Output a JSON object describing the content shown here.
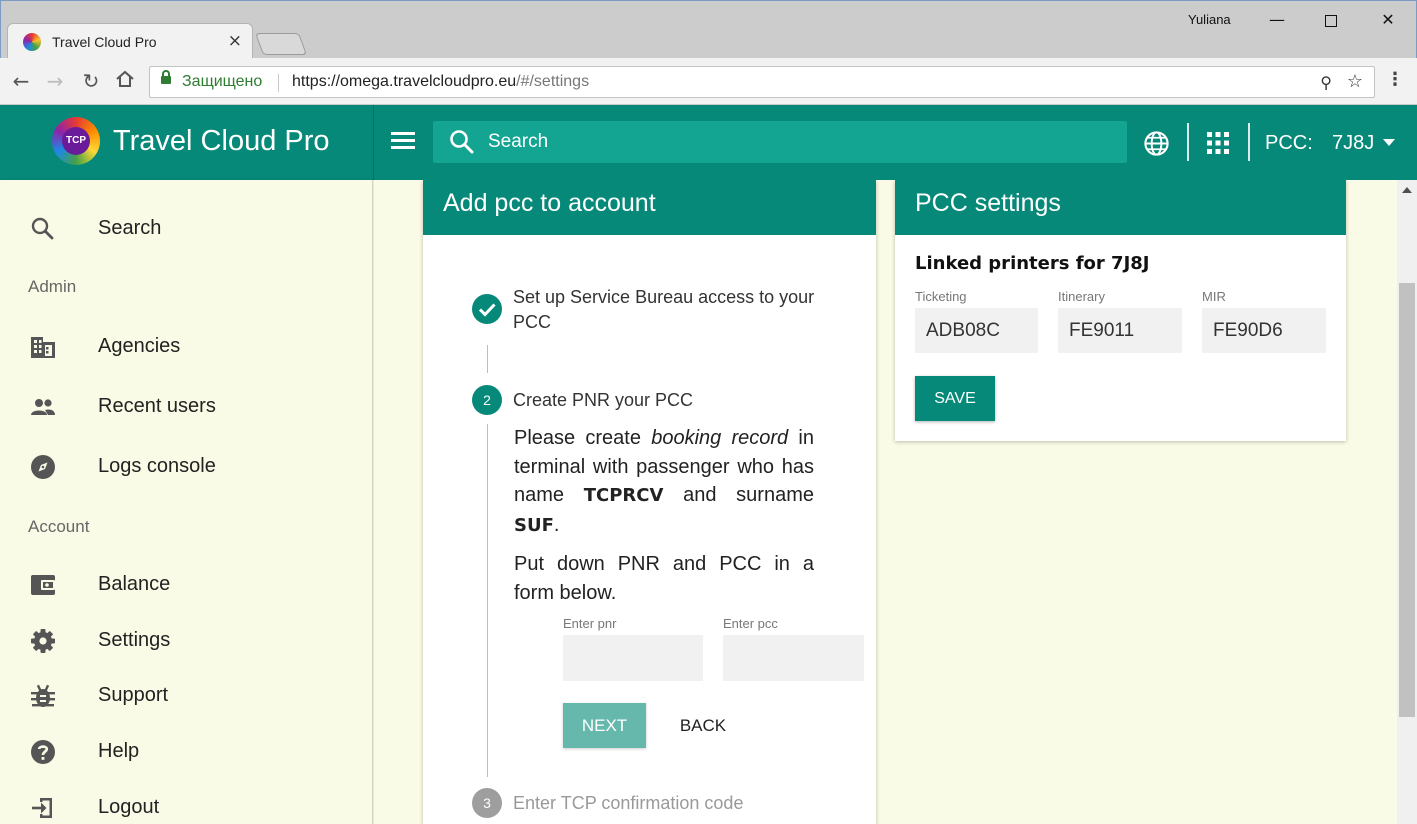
{
  "browser": {
    "tab_title": "Travel Cloud Pro",
    "tab_close": "×",
    "window_user": "Yuliana",
    "secure_label": "Защищено",
    "url_host": "https://omega.travelcloudpro.eu",
    "url_path": "/#/settings"
  },
  "header": {
    "brand_name": "Travel Cloud Pro",
    "logo_text": "TCP",
    "search_placeholder": "Search",
    "pcc_label": "PCC:",
    "pcc_value": "7J8J"
  },
  "sidebar": {
    "search_label": "Search",
    "admin_section": "Admin",
    "account_section": "Account",
    "items": [
      {
        "label": "Agencies",
        "icon": "building-icon"
      },
      {
        "label": "Recent users",
        "icon": "people-icon"
      },
      {
        "label": "Logs console",
        "icon": "compass-icon"
      },
      {
        "label": "Balance",
        "icon": "wallet-icon"
      },
      {
        "label": "Settings",
        "icon": "gear-icon"
      },
      {
        "label": "Support",
        "icon": "bug-icon"
      },
      {
        "label": "Help",
        "icon": "help-icon"
      },
      {
        "label": "Logout",
        "icon": "logout-icon"
      }
    ]
  },
  "add_pcc": {
    "title": "Add pcc to account",
    "steps": [
      {
        "number": "",
        "title": "Set up Service Bureau access to your PCC",
        "status": "done"
      },
      {
        "number": "2",
        "title": "Create PNR your PCC",
        "status": "active"
      },
      {
        "number": "3",
        "title": "Enter TCP confirmation code",
        "status": "pending"
      }
    ],
    "body": {
      "p1_a": "Please create ",
      "p1_em": "booking record",
      "p1_b": " in terminal with passenger who has name ",
      "p1_name": "TCPRCV",
      "p1_c": " and surname ",
      "p1_surname": "SUF",
      "p1_d": ".",
      "p2": "Put down PNR and PCC in a form below."
    },
    "pnr_label": "Enter pnr",
    "pnr_value": "",
    "pcc_label": "Enter pcc",
    "pcc_value": "",
    "next_label": "NEXT",
    "back_label": "BACK"
  },
  "pcc_settings": {
    "title": "PCC settings",
    "subtitle": "Linked printers for 7J8J",
    "fields": [
      {
        "label": "Ticketing",
        "value": "ADB08C"
      },
      {
        "label": "Itinerary",
        "value": "FE9011"
      },
      {
        "label": "MIR",
        "value": "FE90D6"
      }
    ],
    "save_label": "SAVE"
  },
  "colors": {
    "primary": "#07897a",
    "primary_light": "#66b8ad",
    "sidebar_bg": "#fafbe6"
  }
}
